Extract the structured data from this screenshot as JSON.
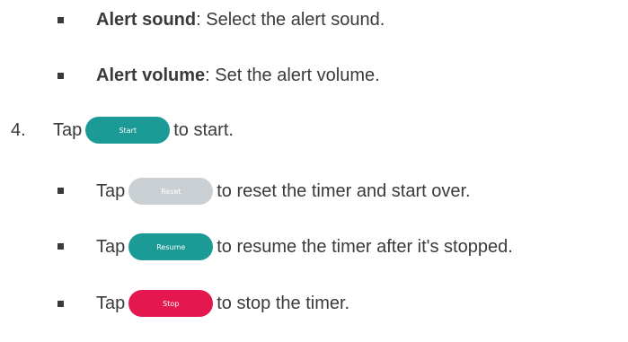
{
  "items": {
    "alert_sound": {
      "title": "Alert sound",
      "desc": ": Select the alert sound."
    },
    "alert_volume": {
      "title": "Alert volume",
      "desc": ": Set the alert volume."
    },
    "step4": {
      "number": "4.",
      "before": "Tap",
      "button": "Start",
      "after": "to start."
    },
    "reset": {
      "before": "Tap",
      "button": "Reset",
      "after": "to reset the timer and start over."
    },
    "resume": {
      "before": "Tap",
      "button": "Resume",
      "after": "to resume the timer after it's stopped."
    },
    "stop": {
      "before": "Tap",
      "button": "Stop",
      "after": "to stop the timer."
    }
  },
  "colors": {
    "teal": "#1b9a96",
    "grey": "#c9cfd3",
    "red": "#e5174f",
    "text": "#3a3a3a"
  }
}
